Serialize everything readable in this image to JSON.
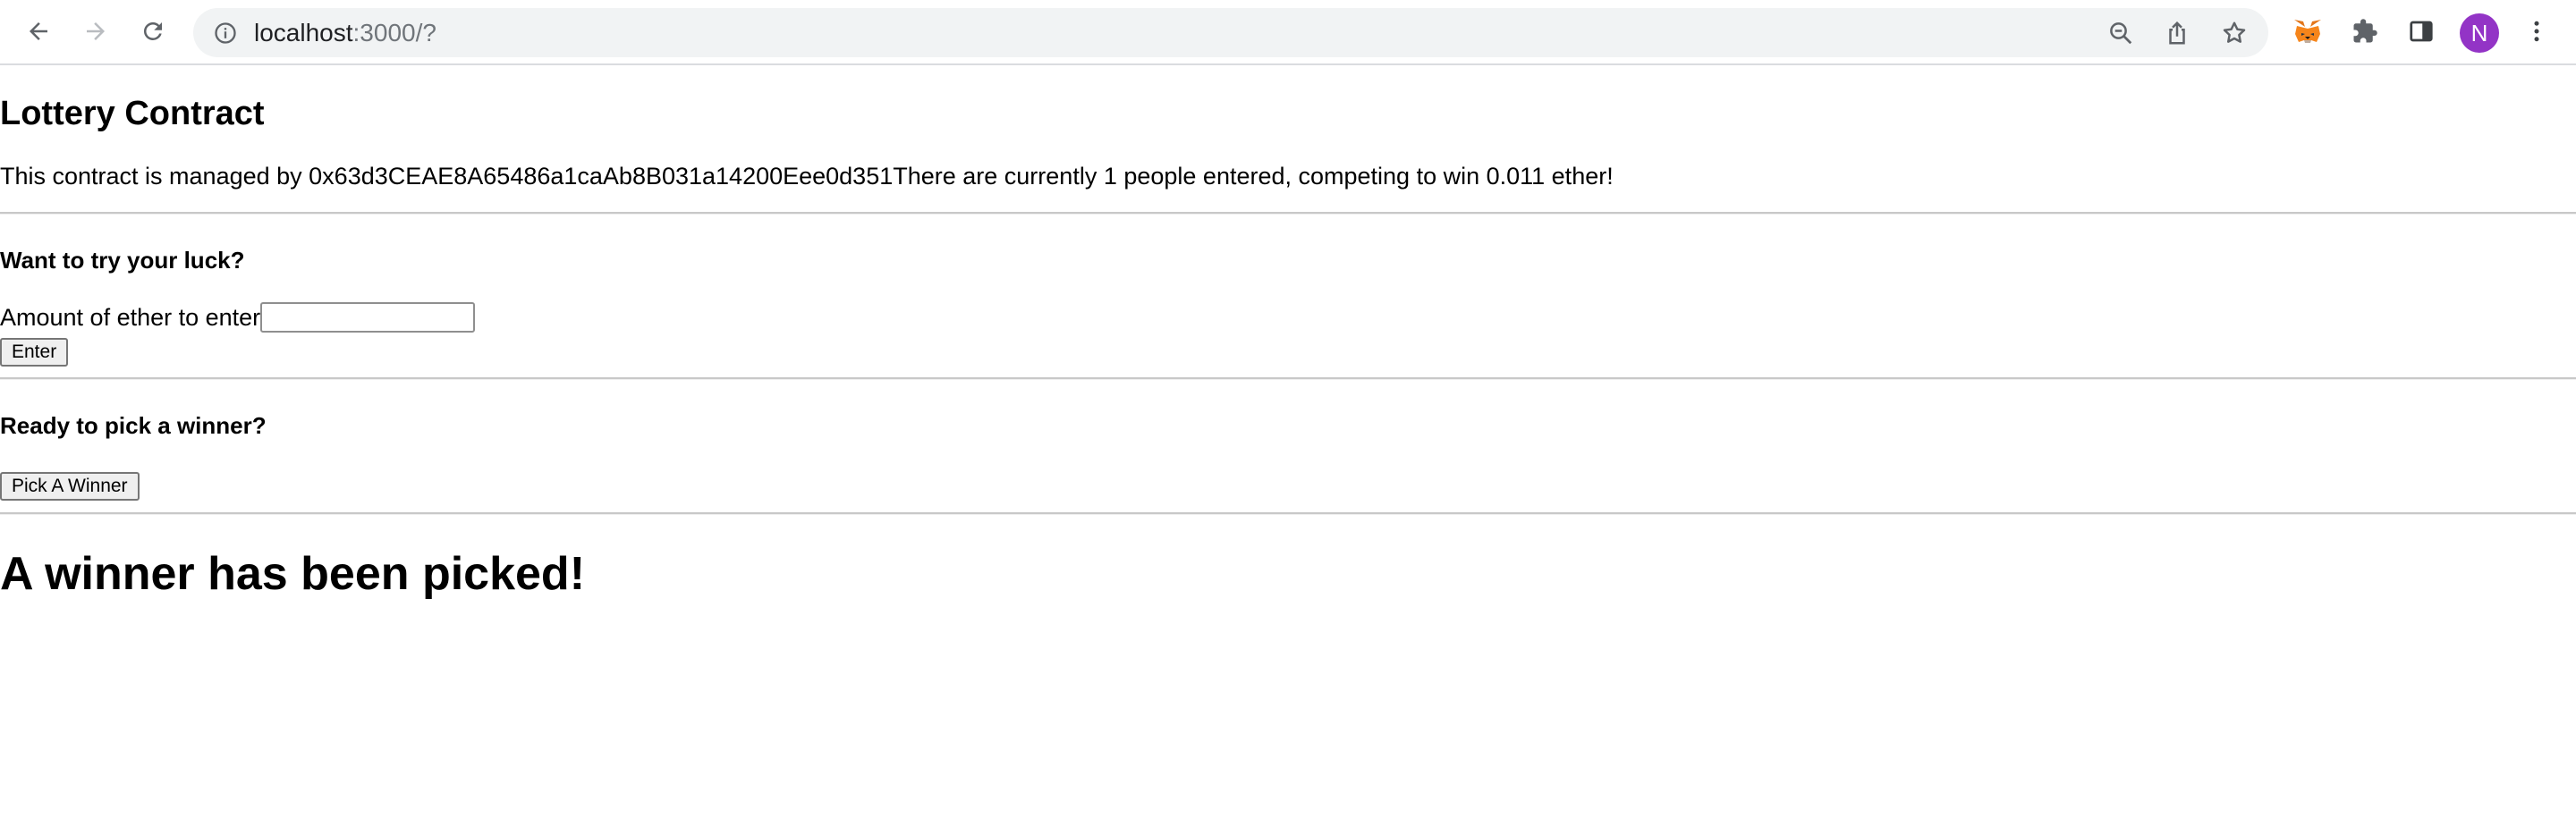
{
  "browser": {
    "url_host": "localhost",
    "url_path": ":3000/?",
    "profile_initial": "N",
    "icons": {
      "back": "back-arrow-icon",
      "forward": "forward-arrow-icon",
      "reload": "reload-icon",
      "site_info": "info-icon",
      "zoom": "zoom-icon",
      "share": "share-icon",
      "bookmark": "star-icon",
      "metamask": "metamask-fox-icon",
      "extensions": "puzzle-piece-icon",
      "side_panel": "side-panel-icon",
      "menu": "kebab-menu-icon"
    },
    "colors": {
      "omnibox_bg": "#f1f3f4",
      "avatar_bg": "#9334c6"
    }
  },
  "page": {
    "title": "Lottery Contract",
    "intro": "This contract is managed by 0x63d3CEAE8A65486a1caAb8B031a14200Eee0d351There are currently 1 people entered, competing to win 0.011 ether!",
    "enter_section": {
      "heading": "Want to try your luck?",
      "amount_label": "Amount of ether to enter",
      "amount_value": "",
      "enter_button": "Enter"
    },
    "pick_section": {
      "heading": "Ready to pick a winner?",
      "pick_button": "Pick A Winner"
    },
    "message": "A winner has been picked!"
  }
}
